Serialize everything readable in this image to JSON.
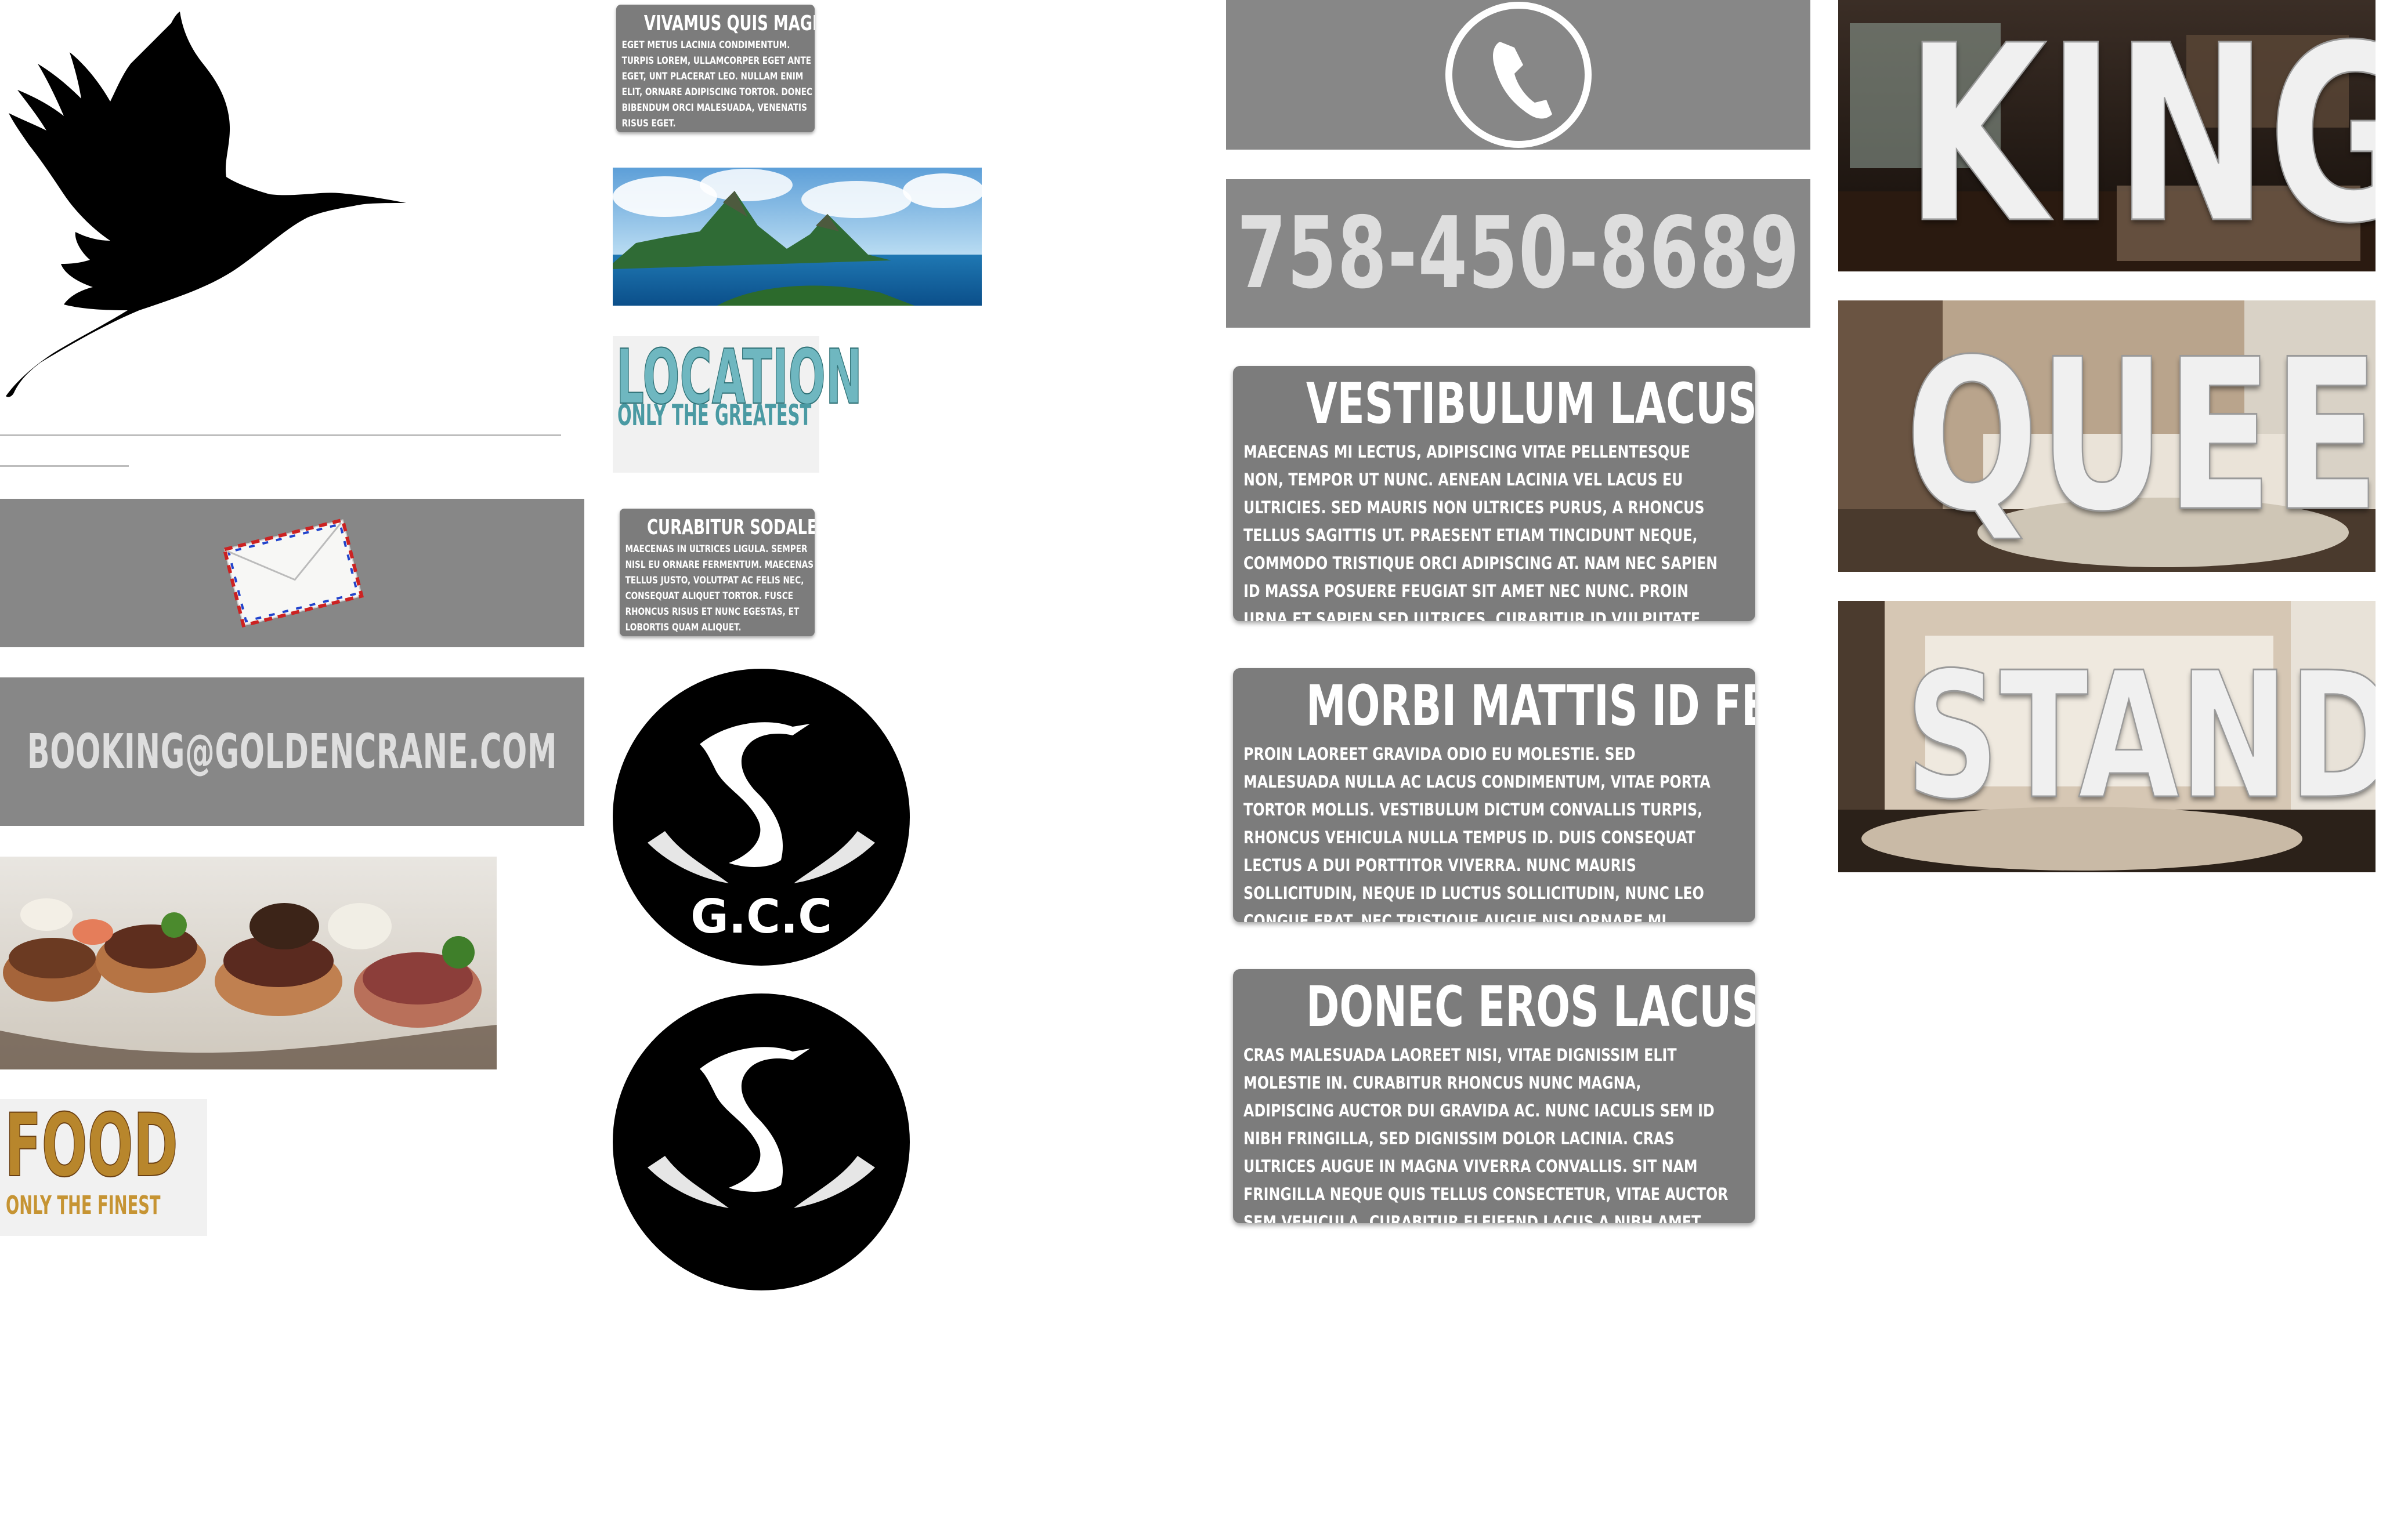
{
  "contact": {
    "email": "BOOKING@GOLDENCRANE.COM",
    "phone": "758-450-8689"
  },
  "small_cards": [
    {
      "title": "VIVAMUS QUIS MAGNA",
      "body": "EGET METUS LACINIA CONDIMENTUM. TURPIS LOREM, ULLAMCORPER EGET ANTE EGET, UNT PLACERAT LEO. NULLAM ENIM ELIT, ORNARE ADIPISCING TORTOR. DONEC BIBENDUM ORCI MALESUADA, VENENATIS RISUS EGET."
    },
    {
      "title": "CURABITUR SODALES",
      "body": "MAECENAS IN ULTRICES LIGULA. SEMPER NISL EU ORNARE FERMENTUM. MAECENAS TELLUS JUSTO, VOLUTPAT AC FELIS NEC, CONSEQUAT ALIQUET TORTOR. FUSCE RHONCUS RISUS ET NUNC EGESTAS, ET LOBORTIS QUAM ALIQUET."
    }
  ],
  "big_cards": [
    {
      "title": "VESTIBULUM LACUS RISUS",
      "body": "MAECENAS MI LECTUS, ADIPISCING VITAE PELLENTESQUE NON, TEMPOR UT NUNC. AENEAN LACINIA VEL LACUS EU ULTRICIES. SED MAURIS NON ULTRICES PURUS, A RHONCUS TELLUS SAGITTIS UT. PRAESENT ETIAM TINCIDUNT NEQUE, COMMODO TRISTIQUE ORCI ADIPISCING AT. NAM NEC SAPIEN ID MASSA POSUERE FEUGIAT SIT AMET NEC NUNC. PROIN URNA ET SAPIEN SED ULTRICES. CURABITUR ID VULPUTATE QUAM."
    },
    {
      "title": "MORBI MATTIS ID FELIS",
      "body": "PROIN LAOREET GRAVIDA ODIO EU MOLESTIE. SED MALESUADA NULLA AC LACUS CONDIMENTUM, VITAE PORTA TORTOR MOLLIS. VESTIBULUM DICTUM CONVALLIS TURPIS, RHONCUS VEHICULA NULLA TEMPUS ID. DUIS CONSEQUAT LECTUS A DUI PORTTITOR VIVERRA. NUNC MAURIS SOLLICITUDIN, NEQUE ID LUCTUS SOLLICITUDIN, NUNC LEO CONGUE ERAT, NEC TRISTIQUE AUGUE NISI ORNARE MI. MAECENAS PELLENTESQUE SEM."
    },
    {
      "title": "DONEC EROS LACUS NUNC",
      "body": "CRAS MALESUADA LAOREET NISI, VITAE DIGNISSIM ELIT MOLESTIE IN. CURABITUR RHONCUS NUNC MAGNA, ADIPISCING AUCTOR DUI GRAVIDA AC. NUNC IACULIS SEM ID NIBH FRINGILLA, SED DIGNISSIM DOLOR LACINIA. CRAS ULTRICES AUGUE IN MAGNA VIVERRA CONVALLIS. SIT NAM FRINGILLA NEQUE QUIS TELLUS CONSECTETUR, VITAE AUCTOR SEM VEHICULA. CURABITUR ELEIFEND LACUS A NIBH AMET DIGNISSIM."
    }
  ],
  "logos": {
    "location_title": "LOCATION",
    "location_sub": "ONLY THE GREATEST",
    "food_title": "FOOD",
    "food_sub": "ONLY THE FINEST",
    "gcc_text": "G.C.C"
  },
  "rooms": [
    {
      "label": "KING"
    },
    {
      "label": "QUEEN"
    },
    {
      "label": "STANDARD"
    }
  ],
  "colors": {
    "banner_gray": "#878787",
    "card_gray": "#7c7c7c",
    "light_text": "#dedede"
  },
  "icons": [
    "crane-silhouette-icon",
    "envelope-icon",
    "phone-icon",
    "crane-logo-icon"
  ]
}
